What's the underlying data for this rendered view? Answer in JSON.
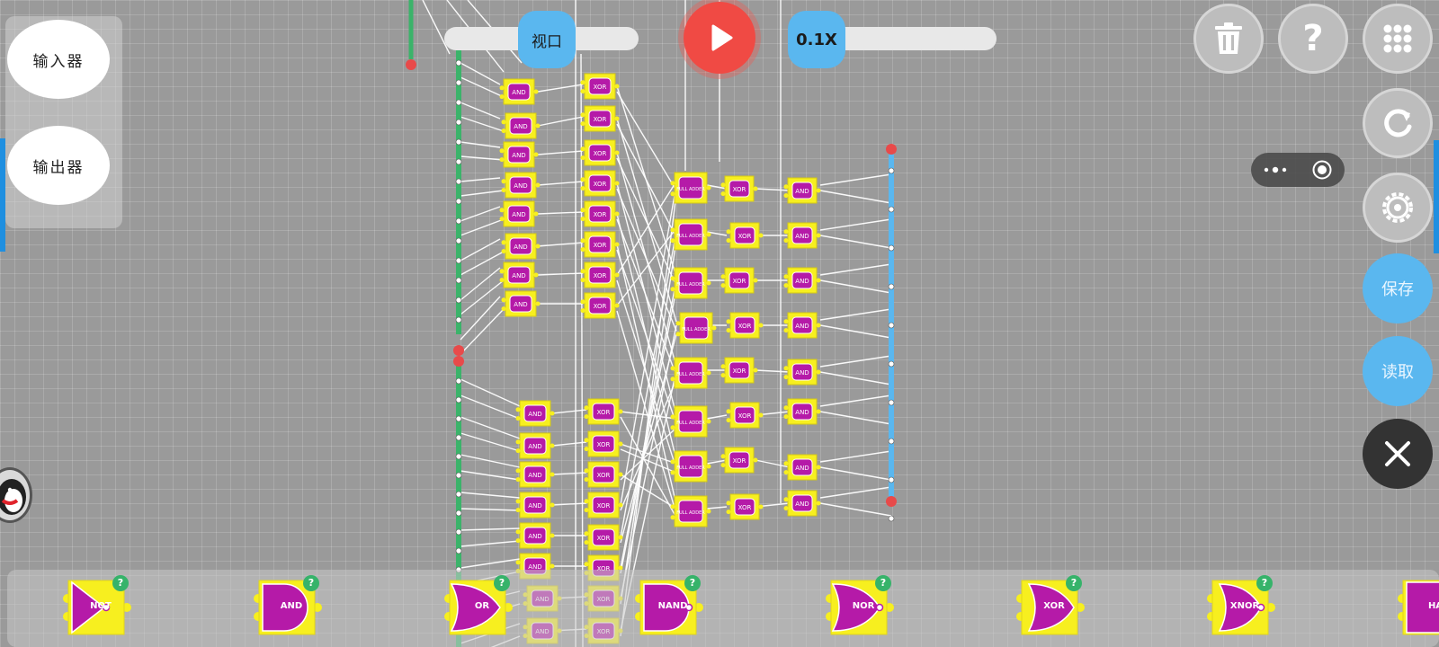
{
  "panel": {
    "input_label": "输入器",
    "output_label": "输出器"
  },
  "top": {
    "viewport_label": "视口",
    "speed_label": "0.1X"
  },
  "right": {
    "save_label": "保存",
    "load_label": "读取",
    "help_glyph": "?"
  },
  "canvas": {
    "upper_and_gates": [
      "AND",
      "AND",
      "AND",
      "AND",
      "AND",
      "AND",
      "AND",
      "AND"
    ],
    "upper_xor_gates": [
      "XOR",
      "XOR",
      "XOR",
      "XOR",
      "XOR",
      "XOR",
      "XOR",
      "XOR"
    ],
    "lower_and_gates": [
      "AND",
      "AND",
      "AND",
      "AND",
      "AND",
      "AND",
      "AND",
      "AND"
    ],
    "lower_xor_gates": [
      "XOR",
      "XOR",
      "XOR",
      "XOR",
      "XOR",
      "XOR",
      "XOR",
      "XOR"
    ],
    "adder_gates": [
      "FULL ADDER",
      "FULL ADDER",
      "FULL ADDER",
      "FULL ADDER",
      "FULL ADDER",
      "FULL ADDER",
      "FULL ADDER",
      "FULL ADDER"
    ],
    "middle_xor_gates": [
      "XOR",
      "XOR",
      "XOR",
      "XOR",
      "XOR",
      "XOR",
      "XOR",
      "XOR"
    ],
    "right_and_gates": [
      "AND",
      "AND",
      "AND",
      "AND",
      "AND",
      "AND",
      "AND",
      "AND"
    ]
  },
  "palette": {
    "items": [
      {
        "label": "NOT",
        "help": "?"
      },
      {
        "label": "AND",
        "help": "?"
      },
      {
        "label": "OR",
        "help": "?"
      },
      {
        "label": "NAND",
        "help": "?"
      },
      {
        "label": "NOR",
        "help": "?"
      },
      {
        "label": "XOR",
        "help": "?"
      },
      {
        "label": "XNOR",
        "help": "?"
      },
      {
        "label": "HA",
        "help": "?"
      }
    ]
  },
  "colors": {
    "gate_fill": "#f7ef1f",
    "gate_inner": "#b51aa8",
    "accent_blue": "#5ab7ef",
    "play_red": "#f04a44",
    "input_bus": "#3bb36a",
    "output_bus": "#5ab7ef"
  }
}
